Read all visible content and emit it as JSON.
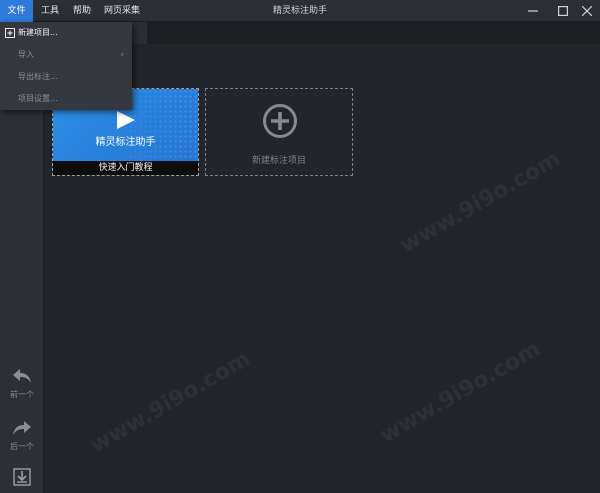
{
  "window": {
    "title": "精灵标注助手",
    "controls": {
      "minimize_icon": "minimize-icon",
      "maximize_icon": "maximize-icon",
      "close_icon": "close-icon"
    }
  },
  "menubar": {
    "items": [
      {
        "label": "文件",
        "active": true
      },
      {
        "label": "工具",
        "active": false
      },
      {
        "label": "帮助",
        "active": false
      },
      {
        "label": "网页采集",
        "active": false
      }
    ]
  },
  "file_menu": {
    "items": [
      {
        "label": "新建项目...",
        "enabled": true,
        "icon": "new-project-icon"
      },
      {
        "label": "导入",
        "enabled": false,
        "submenu": true
      },
      {
        "label": "导出标注...",
        "enabled": false
      },
      {
        "label": "项目设置...",
        "enabled": false
      }
    ]
  },
  "sidebar": {
    "tools": [
      {
        "label": "前一个",
        "icon": "undo-arrow-icon"
      },
      {
        "label": "后一个",
        "icon": "redo-arrow-icon"
      },
      {
        "label": "",
        "icon": "download-icon"
      }
    ]
  },
  "main": {
    "tutorial_card": {
      "brand": "精灵标注助手",
      "caption": "快速入门教程"
    },
    "new_project_card": {
      "label": "新建标注项目",
      "icon": "plus-circle-icon"
    }
  },
  "watermark": "www.9i9o.com",
  "colors": {
    "accent": "#2f7bdc",
    "background": "#22252b",
    "sidebar": "#2c2f35",
    "menu": "#34373d"
  }
}
